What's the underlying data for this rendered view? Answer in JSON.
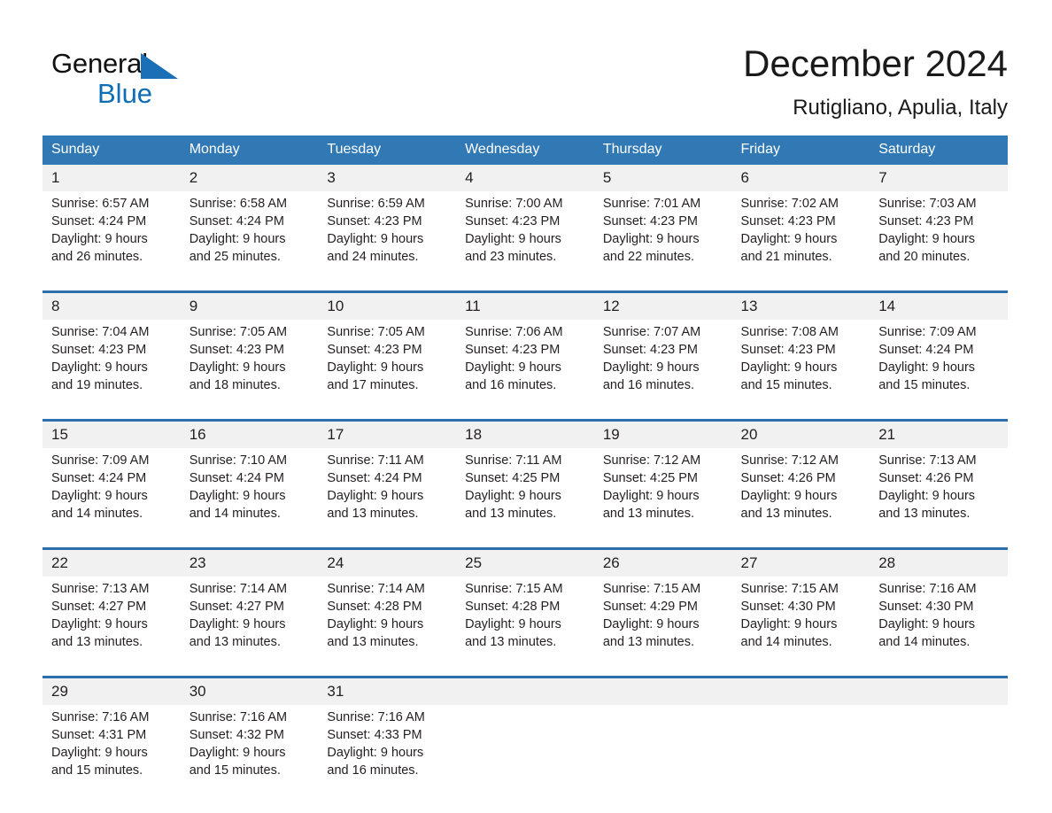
{
  "logo": {
    "word_one": "General",
    "word_two": "Blue",
    "triangle_color": "#1a6fb5",
    "blue_text_color": "#0f6db4"
  },
  "header": {
    "title": "December 2024",
    "subtitle": "Rutigliano, Apulia, Italy"
  },
  "theme": {
    "header_blue": "#3179b5",
    "separator_blue": "#2c6fac",
    "date_band_gray": "#f1f1f1",
    "text_color": "#231f20"
  },
  "weekdays": [
    "Sunday",
    "Monday",
    "Tuesday",
    "Wednesday",
    "Thursday",
    "Friday",
    "Saturday"
  ],
  "weeks": [
    {
      "dates": [
        "1",
        "2",
        "3",
        "4",
        "5",
        "6",
        "7"
      ],
      "cells": [
        {
          "sunrise": "Sunrise: 6:57 AM",
          "sunset": "Sunset: 4:24 PM",
          "daylight_1": "Daylight: 9 hours",
          "daylight_2": "and 26 minutes."
        },
        {
          "sunrise": "Sunrise: 6:58 AM",
          "sunset": "Sunset: 4:24 PM",
          "daylight_1": "Daylight: 9 hours",
          "daylight_2": "and 25 minutes."
        },
        {
          "sunrise": "Sunrise: 6:59 AM",
          "sunset": "Sunset: 4:23 PM",
          "daylight_1": "Daylight: 9 hours",
          "daylight_2": "and 24 minutes."
        },
        {
          "sunrise": "Sunrise: 7:00 AM",
          "sunset": "Sunset: 4:23 PM",
          "daylight_1": "Daylight: 9 hours",
          "daylight_2": "and 23 minutes."
        },
        {
          "sunrise": "Sunrise: 7:01 AM",
          "sunset": "Sunset: 4:23 PM",
          "daylight_1": "Daylight: 9 hours",
          "daylight_2": "and 22 minutes."
        },
        {
          "sunrise": "Sunrise: 7:02 AM",
          "sunset": "Sunset: 4:23 PM",
          "daylight_1": "Daylight: 9 hours",
          "daylight_2": "and 21 minutes."
        },
        {
          "sunrise": "Sunrise: 7:03 AM",
          "sunset": "Sunset: 4:23 PM",
          "daylight_1": "Daylight: 9 hours",
          "daylight_2": "and 20 minutes."
        }
      ]
    },
    {
      "dates": [
        "8",
        "9",
        "10",
        "11",
        "12",
        "13",
        "14"
      ],
      "cells": [
        {
          "sunrise": "Sunrise: 7:04 AM",
          "sunset": "Sunset: 4:23 PM",
          "daylight_1": "Daylight: 9 hours",
          "daylight_2": "and 19 minutes."
        },
        {
          "sunrise": "Sunrise: 7:05 AM",
          "sunset": "Sunset: 4:23 PM",
          "daylight_1": "Daylight: 9 hours",
          "daylight_2": "and 18 minutes."
        },
        {
          "sunrise": "Sunrise: 7:05 AM",
          "sunset": "Sunset: 4:23 PM",
          "daylight_1": "Daylight: 9 hours",
          "daylight_2": "and 17 minutes."
        },
        {
          "sunrise": "Sunrise: 7:06 AM",
          "sunset": "Sunset: 4:23 PM",
          "daylight_1": "Daylight: 9 hours",
          "daylight_2": "and 16 minutes."
        },
        {
          "sunrise": "Sunrise: 7:07 AM",
          "sunset": "Sunset: 4:23 PM",
          "daylight_1": "Daylight: 9 hours",
          "daylight_2": "and 16 minutes."
        },
        {
          "sunrise": "Sunrise: 7:08 AM",
          "sunset": "Sunset: 4:23 PM",
          "daylight_1": "Daylight: 9 hours",
          "daylight_2": "and 15 minutes."
        },
        {
          "sunrise": "Sunrise: 7:09 AM",
          "sunset": "Sunset: 4:24 PM",
          "daylight_1": "Daylight: 9 hours",
          "daylight_2": "and 15 minutes."
        }
      ]
    },
    {
      "dates": [
        "15",
        "16",
        "17",
        "18",
        "19",
        "20",
        "21"
      ],
      "cells": [
        {
          "sunrise": "Sunrise: 7:09 AM",
          "sunset": "Sunset: 4:24 PM",
          "daylight_1": "Daylight: 9 hours",
          "daylight_2": "and 14 minutes."
        },
        {
          "sunrise": "Sunrise: 7:10 AM",
          "sunset": "Sunset: 4:24 PM",
          "daylight_1": "Daylight: 9 hours",
          "daylight_2": "and 14 minutes."
        },
        {
          "sunrise": "Sunrise: 7:11 AM",
          "sunset": "Sunset: 4:24 PM",
          "daylight_1": "Daylight: 9 hours",
          "daylight_2": "and 13 minutes."
        },
        {
          "sunrise": "Sunrise: 7:11 AM",
          "sunset": "Sunset: 4:25 PM",
          "daylight_1": "Daylight: 9 hours",
          "daylight_2": "and 13 minutes."
        },
        {
          "sunrise": "Sunrise: 7:12 AM",
          "sunset": "Sunset: 4:25 PM",
          "daylight_1": "Daylight: 9 hours",
          "daylight_2": "and 13 minutes."
        },
        {
          "sunrise": "Sunrise: 7:12 AM",
          "sunset": "Sunset: 4:26 PM",
          "daylight_1": "Daylight: 9 hours",
          "daylight_2": "and 13 minutes."
        },
        {
          "sunrise": "Sunrise: 7:13 AM",
          "sunset": "Sunset: 4:26 PM",
          "daylight_1": "Daylight: 9 hours",
          "daylight_2": "and 13 minutes."
        }
      ]
    },
    {
      "dates": [
        "22",
        "23",
        "24",
        "25",
        "26",
        "27",
        "28"
      ],
      "cells": [
        {
          "sunrise": "Sunrise: 7:13 AM",
          "sunset": "Sunset: 4:27 PM",
          "daylight_1": "Daylight: 9 hours",
          "daylight_2": "and 13 minutes."
        },
        {
          "sunrise": "Sunrise: 7:14 AM",
          "sunset": "Sunset: 4:27 PM",
          "daylight_1": "Daylight: 9 hours",
          "daylight_2": "and 13 minutes."
        },
        {
          "sunrise": "Sunrise: 7:14 AM",
          "sunset": "Sunset: 4:28 PM",
          "daylight_1": "Daylight: 9 hours",
          "daylight_2": "and 13 minutes."
        },
        {
          "sunrise": "Sunrise: 7:15 AM",
          "sunset": "Sunset: 4:28 PM",
          "daylight_1": "Daylight: 9 hours",
          "daylight_2": "and 13 minutes."
        },
        {
          "sunrise": "Sunrise: 7:15 AM",
          "sunset": "Sunset: 4:29 PM",
          "daylight_1": "Daylight: 9 hours",
          "daylight_2": "and 13 minutes."
        },
        {
          "sunrise": "Sunrise: 7:15 AM",
          "sunset": "Sunset: 4:30 PM",
          "daylight_1": "Daylight: 9 hours",
          "daylight_2": "and 14 minutes."
        },
        {
          "sunrise": "Sunrise: 7:16 AM",
          "sunset": "Sunset: 4:30 PM",
          "daylight_1": "Daylight: 9 hours",
          "daylight_2": "and 14 minutes."
        }
      ]
    },
    {
      "dates": [
        "29",
        "30",
        "31",
        "",
        "",
        "",
        ""
      ],
      "cells": [
        {
          "sunrise": "Sunrise: 7:16 AM",
          "sunset": "Sunset: 4:31 PM",
          "daylight_1": "Daylight: 9 hours",
          "daylight_2": "and 15 minutes."
        },
        {
          "sunrise": "Sunrise: 7:16 AM",
          "sunset": "Sunset: 4:32 PM",
          "daylight_1": "Daylight: 9 hours",
          "daylight_2": "and 15 minutes."
        },
        {
          "sunrise": "Sunrise: 7:16 AM",
          "sunset": "Sunset: 4:33 PM",
          "daylight_1": "Daylight: 9 hours",
          "daylight_2": "and 16 minutes."
        },
        {
          "sunrise": "",
          "sunset": "",
          "daylight_1": "",
          "daylight_2": ""
        },
        {
          "sunrise": "",
          "sunset": "",
          "daylight_1": "",
          "daylight_2": ""
        },
        {
          "sunrise": "",
          "sunset": "",
          "daylight_1": "",
          "daylight_2": ""
        },
        {
          "sunrise": "",
          "sunset": "",
          "daylight_1": "",
          "daylight_2": ""
        }
      ]
    }
  ]
}
